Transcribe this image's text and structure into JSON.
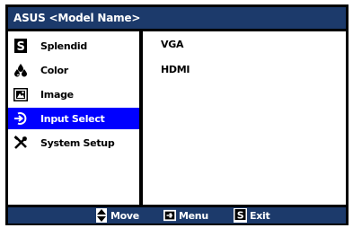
{
  "header": {
    "title": "ASUS <Model Name>"
  },
  "menu": {
    "items": [
      {
        "label": "Splendid",
        "icon": "splendid-s-icon"
      },
      {
        "label": "Color",
        "icon": "color-drops-icon"
      },
      {
        "label": "Image",
        "icon": "image-icon"
      },
      {
        "label": "Input Select",
        "icon": "input-select-icon",
        "selected": true
      },
      {
        "label": "System Setup",
        "icon": "system-setup-tools-icon"
      }
    ],
    "selected_color": "#0000ff"
  },
  "options": [
    "VGA",
    "HDMI"
  ],
  "footer": {
    "move": {
      "label": "Move",
      "icon": "up-down-arrow-icon"
    },
    "menu": {
      "label": "Menu",
      "icon": "menu-enter-icon"
    },
    "exit": {
      "label": "Exit",
      "icon": "exit-s-icon"
    }
  },
  "colors": {
    "title_bar": "#1c3a6b",
    "frame": "#000000",
    "panel": "#ffffff"
  }
}
